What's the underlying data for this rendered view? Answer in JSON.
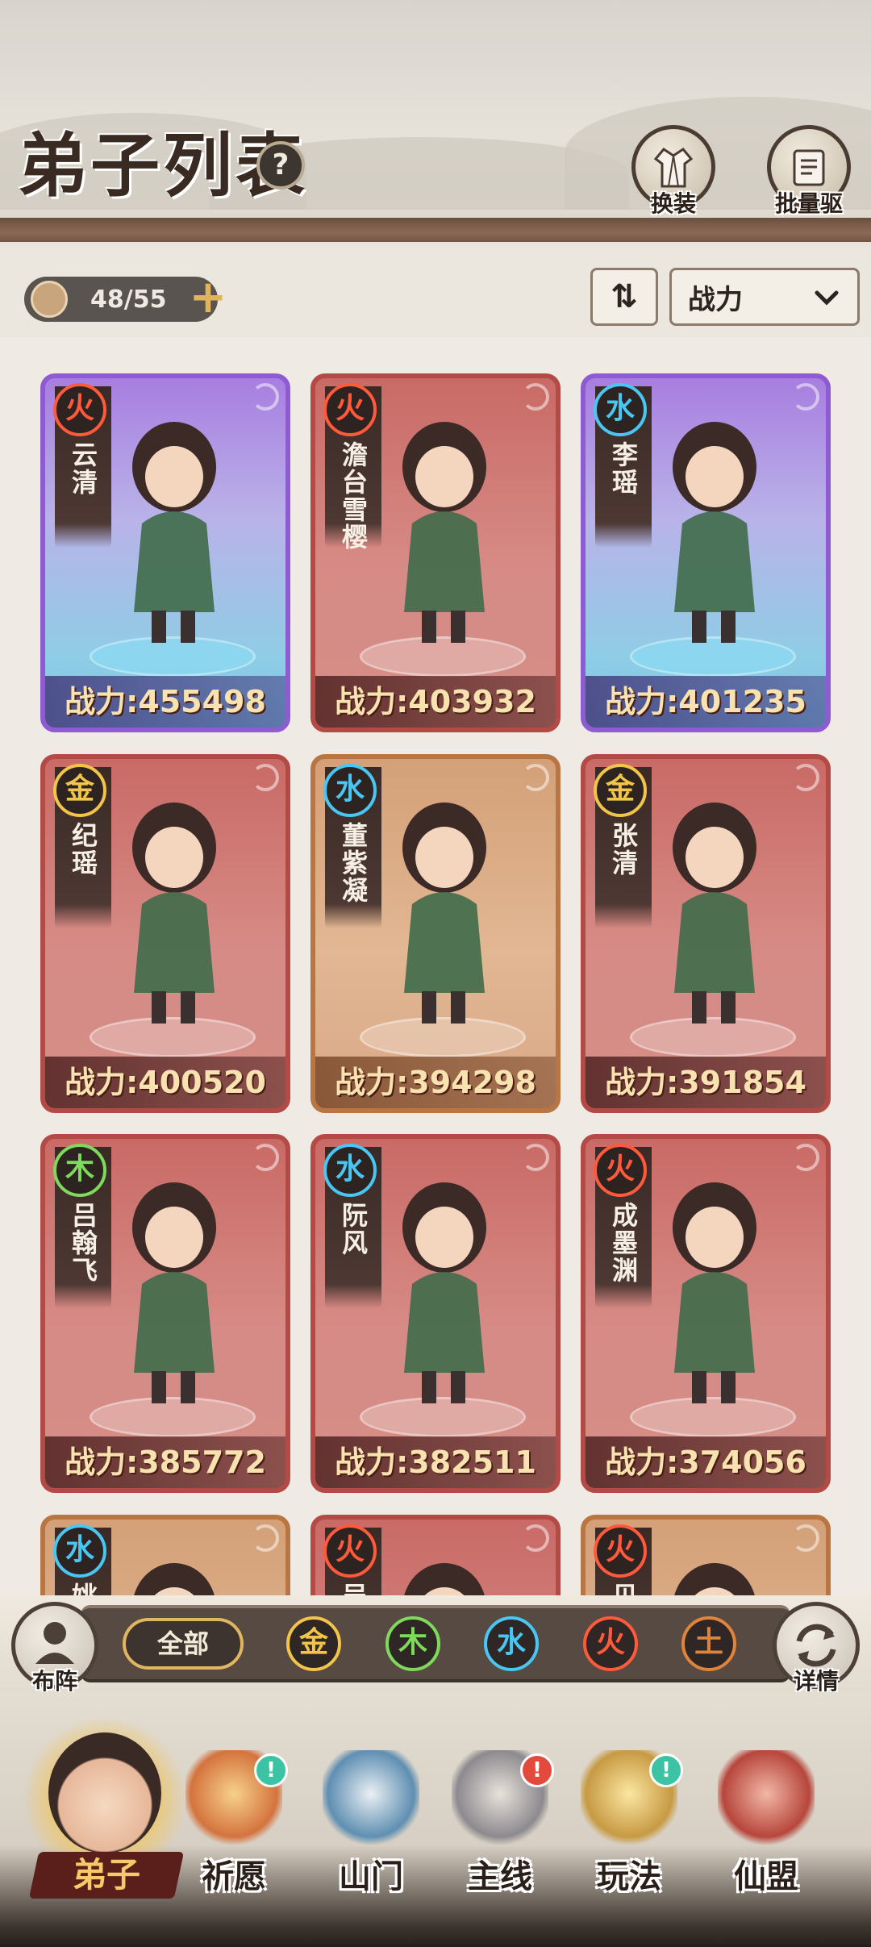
{
  "header": {
    "title": "弟子列表",
    "help_glyph": "?",
    "buttons": [
      {
        "id": "outfit",
        "label": "换装",
        "icon": "robe-icon"
      },
      {
        "id": "dismiss",
        "label": "批量驱逐",
        "icon": "scroll-icon"
      }
    ]
  },
  "toolbar": {
    "disciple_count": "48/55",
    "sort_label": "战力",
    "sort_toggle_glyph": "⇅"
  },
  "colors": {
    "fire": "#ff5a3c",
    "water": "#49c6f2",
    "metal": "#f2c44a",
    "wood": "#7fd95b",
    "earth": "#e0843b"
  },
  "disciples": [
    {
      "name": "云清",
      "element": "火",
      "element_key": "fire",
      "power_label": "战力:455498",
      "frame": "purple"
    },
    {
      "name": "澹台雪樱",
      "element": "火",
      "element_key": "fire",
      "power_label": "战力:403932",
      "frame": "red"
    },
    {
      "name": "李瑶",
      "element": "水",
      "element_key": "water",
      "power_label": "战力:401235",
      "frame": "purple"
    },
    {
      "name": "纪瑶",
      "element": "金",
      "element_key": "metal",
      "power_label": "战力:400520",
      "frame": "red"
    },
    {
      "name": "董紫凝",
      "element": "水",
      "element_key": "water",
      "power_label": "战力:394298",
      "frame": "orange"
    },
    {
      "name": "张清",
      "element": "金",
      "element_key": "metal",
      "power_label": "战力:391854",
      "frame": "red"
    },
    {
      "name": "吕翰飞",
      "element": "木",
      "element_key": "wood",
      "power_label": "战力:385772",
      "frame": "red"
    },
    {
      "name": "阮风",
      "element": "水",
      "element_key": "water",
      "power_label": "战力:382511",
      "frame": "red"
    },
    {
      "name": "成墨渊",
      "element": "火",
      "element_key": "fire",
      "power_label": "战力:374056",
      "frame": "red"
    },
    {
      "name": "姚",
      "element": "水",
      "element_key": "water",
      "power_label": "",
      "frame": "orange"
    },
    {
      "name": "吴",
      "element": "火",
      "element_key": "fire",
      "power_label": "",
      "frame": "red"
    },
    {
      "name": "贝",
      "element": "火",
      "element_key": "fire",
      "power_label": "",
      "frame": "orange"
    }
  ],
  "filter": {
    "formation_label": "布阵",
    "details_label": "详情",
    "all_label": "全部",
    "elements": [
      {
        "label": "金",
        "key": "metal"
      },
      {
        "label": "木",
        "key": "wood"
      },
      {
        "label": "水",
        "key": "water"
      },
      {
        "label": "火",
        "key": "fire"
      },
      {
        "label": "土",
        "key": "earth"
      }
    ]
  },
  "nav": {
    "active": {
      "label": "弟子"
    },
    "items": [
      {
        "label": "祈愿",
        "badge": "!",
        "badge_color": "green"
      },
      {
        "label": "山门",
        "badge": "",
        "badge_color": ""
      },
      {
        "label": "主线",
        "badge": "!",
        "badge_color": "red"
      },
      {
        "label": "玩法",
        "badge": "!",
        "badge_color": "green"
      },
      {
        "label": "仙盟",
        "badge": "",
        "badge_color": ""
      }
    ]
  }
}
